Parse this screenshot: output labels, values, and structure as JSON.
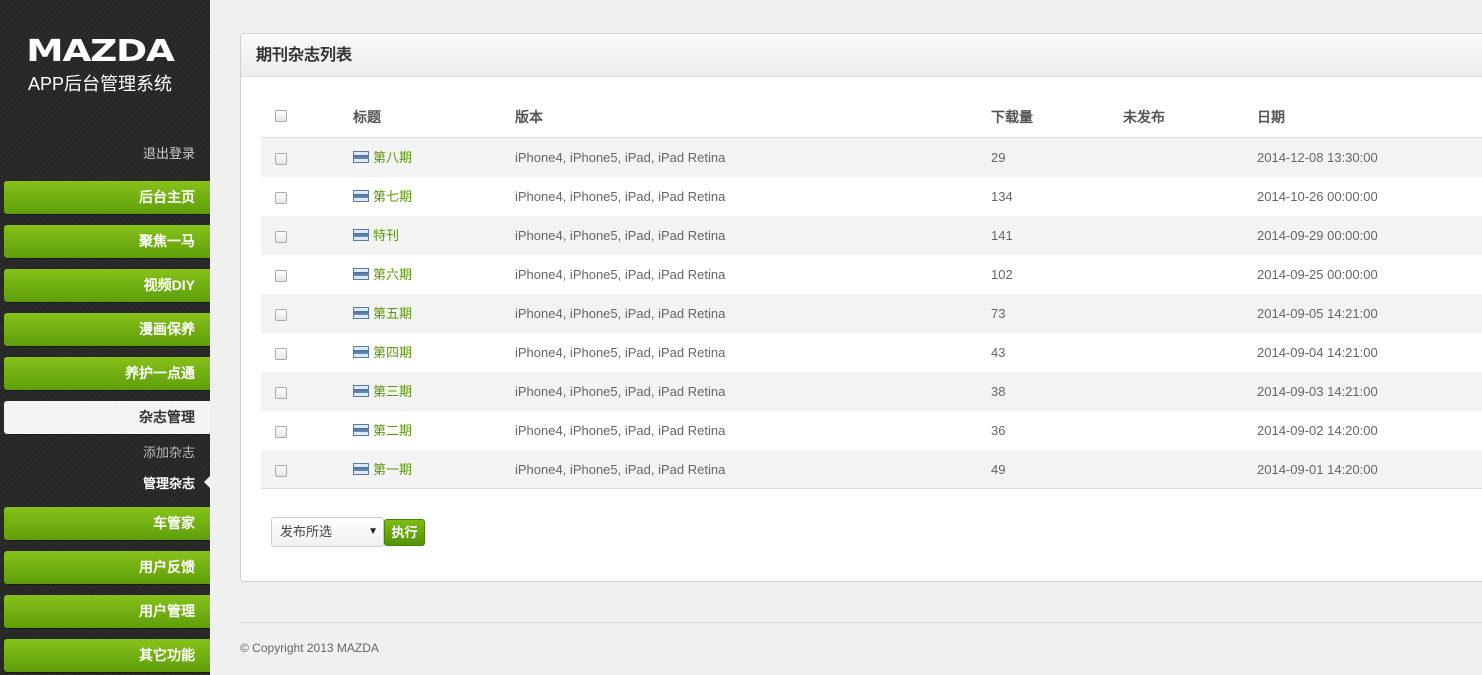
{
  "brand": {
    "logo_text": "MAZDA",
    "system_title": "APP后台管理系统",
    "logout_label": "退出登录"
  },
  "nav": {
    "items": [
      {
        "label": "后台主页"
      },
      {
        "label": "聚焦一马"
      },
      {
        "label": "视频DIY"
      },
      {
        "label": "漫画保养"
      },
      {
        "label": "养护一点通"
      },
      {
        "label": "杂志管理"
      },
      {
        "label": "车管家"
      },
      {
        "label": "用户反馈"
      },
      {
        "label": "用户管理"
      },
      {
        "label": "其它功能"
      }
    ],
    "sub_items": [
      {
        "label": "添加杂志"
      },
      {
        "label": "管理杂志"
      }
    ]
  },
  "panel": {
    "title": "期刊杂志列表",
    "columns": {
      "title": "标题",
      "version": "版本",
      "downloads": "下载量",
      "unpublished": "未发布",
      "date": "日期"
    },
    "rows": [
      {
        "title": "第八期",
        "version": "iPhone4, iPhone5, iPad, iPad Retina",
        "downloads": "29",
        "unpublished": "",
        "date": "2014-12-08 13:30:00"
      },
      {
        "title": "第七期",
        "version": "iPhone4, iPhone5, iPad, iPad Retina",
        "downloads": "134",
        "unpublished": "",
        "date": "2014-10-26 00:00:00"
      },
      {
        "title": "特刊",
        "version": "iPhone4, iPhone5, iPad, iPad Retina",
        "downloads": "141",
        "unpublished": "",
        "date": "2014-09-29 00:00:00"
      },
      {
        "title": "第六期",
        "version": "iPhone4, iPhone5, iPad, iPad Retina",
        "downloads": "102",
        "unpublished": "",
        "date": "2014-09-25 00:00:00"
      },
      {
        "title": "第五期",
        "version": "iPhone4, iPhone5, iPad, iPad Retina",
        "downloads": "73",
        "unpublished": "",
        "date": "2014-09-05 14:21:00"
      },
      {
        "title": "第四期",
        "version": "iPhone4, iPhone5, iPad, iPad Retina",
        "downloads": "43",
        "unpublished": "",
        "date": "2014-09-04 14:21:00"
      },
      {
        "title": "第三期",
        "version": "iPhone4, iPhone5, iPad, iPad Retina",
        "downloads": "38",
        "unpublished": "",
        "date": "2014-09-03 14:21:00"
      },
      {
        "title": "第二期",
        "version": "iPhone4, iPhone5, iPad, iPad Retina",
        "downloads": "36",
        "unpublished": "",
        "date": "2014-09-02 14:20:00"
      },
      {
        "title": "第一期",
        "version": "iPhone4, iPhone5, iPad, iPad Retina",
        "downloads": "49",
        "unpublished": "",
        "date": "2014-09-01 14:20:00"
      }
    ],
    "bulk_action": {
      "selected": "发布所选",
      "execute_label": "执行"
    }
  },
  "footer": {
    "copyright": "© Copyright 2013 MAZDA"
  },
  "colors": {
    "accent_green": "#6aae0e",
    "link_green": "#5a9a08",
    "sidebar_bg": "#292929"
  }
}
